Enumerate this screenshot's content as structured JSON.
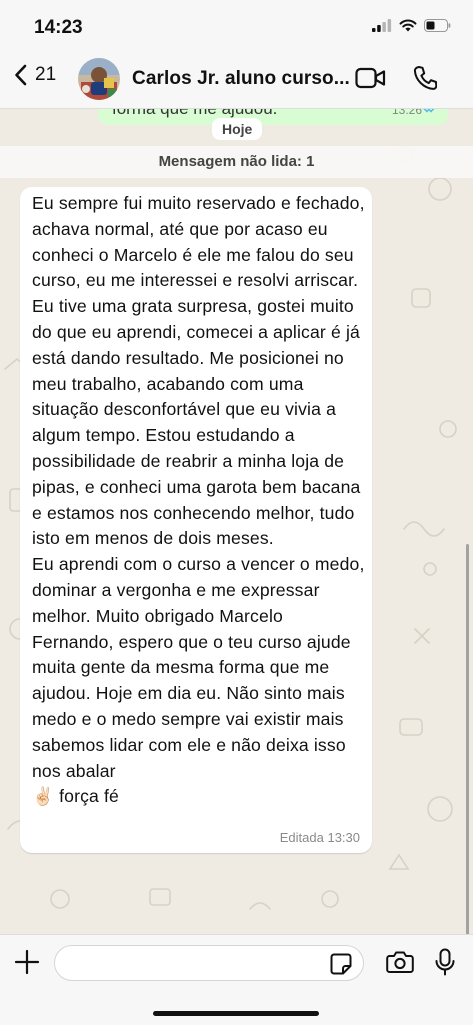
{
  "status_bar": {
    "time": "14:23",
    "icons": [
      "cellular-signal-icon",
      "wifi-icon",
      "battery-icon"
    ]
  },
  "header": {
    "back_count": "21",
    "contact_name": "Carlos Jr. aluno curso...",
    "icons": [
      "back-chevron-icon",
      "video-camera-icon",
      "phone-icon"
    ]
  },
  "chat": {
    "previous_message_partial": "forma que me ajudou.",
    "previous_message_time": "13:26",
    "day_label": "Hoje",
    "unread_banner": "Mensagem não lida: 1",
    "message": {
      "text": "Eu sempre fui muito reservado e fechado, achava normal, até que por acaso eu conheci o Marcelo é ele me falou do seu curso, eu me interessei e resolvi arriscar. Eu tive uma grata surpresa, gostei muito do que eu aprendi, comecei a aplicar é já está dando resultado. Me posicionei no meu trabalho, acabando com uma situação desconfortável que eu vivia a algum tempo. Estou estudando a possibilidade de reabrir a minha loja de pipas, e conheci uma garota bem bacana e estamos nos conhecendo melhor, tudo isto em menos de dois meses.\nEu aprendi com o curso a vencer o medo, dominar a vergonha e me expressar melhor. Muito obrigado Marcelo Fernando, espero que o teu curso ajude muita gente da mesma forma que me ajudou. Hoje em dia eu. Não sinto mais medo e o medo sempre vai existir mais sabemos lidar com ele e não deixa isso nos abalar\n✌🏻 força fé",
      "meta": "Editada 13:30"
    }
  },
  "input": {
    "placeholder": "",
    "icons": [
      "plus-icon",
      "sticker-icon",
      "camera-icon",
      "microphone-icon"
    ]
  },
  "colors": {
    "background": "#efeae2",
    "bars": "#f7f7f7",
    "incoming_bubble": "#ffffff",
    "outgoing_bubble": "#d9fdd3",
    "read_ticks": "#53bdeb"
  }
}
